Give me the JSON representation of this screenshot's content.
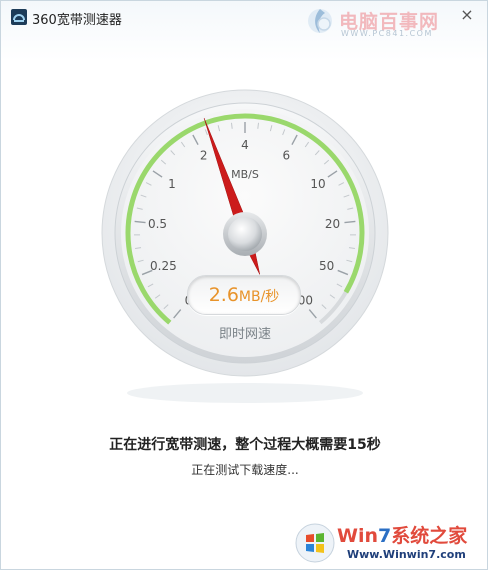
{
  "window": {
    "title": "360宽带测速器"
  },
  "titlebar": {
    "close_icon": "×"
  },
  "watermark_top": {
    "text": "电脑百事网",
    "url": "WWW.PC841.COM"
  },
  "gauge": {
    "unit": "MB/S",
    "ticks": [
      "0",
      "0.25",
      "0.5",
      "1",
      "2",
      "4",
      "6",
      "10",
      "20",
      "50",
      "100"
    ],
    "needle_value_mb": 2.6,
    "progress_fraction": 0.93,
    "instant_label": "即时网速"
  },
  "readout": {
    "value": "2.6",
    "unit": "MB/秒"
  },
  "status": {
    "main": "正在进行宽带测速，整个过程大概需要15秒",
    "sub": "正在测试下载速度..."
  },
  "watermark_bottom": {
    "title_prefix": "Win",
    "title_num": "7",
    "title_suffix": "系统之家",
    "url": "Www.Winwin7.com"
  },
  "colors": {
    "progress_arc": "#9ad86c",
    "needle": "#cc1b1b",
    "readout": "#e8932a"
  }
}
